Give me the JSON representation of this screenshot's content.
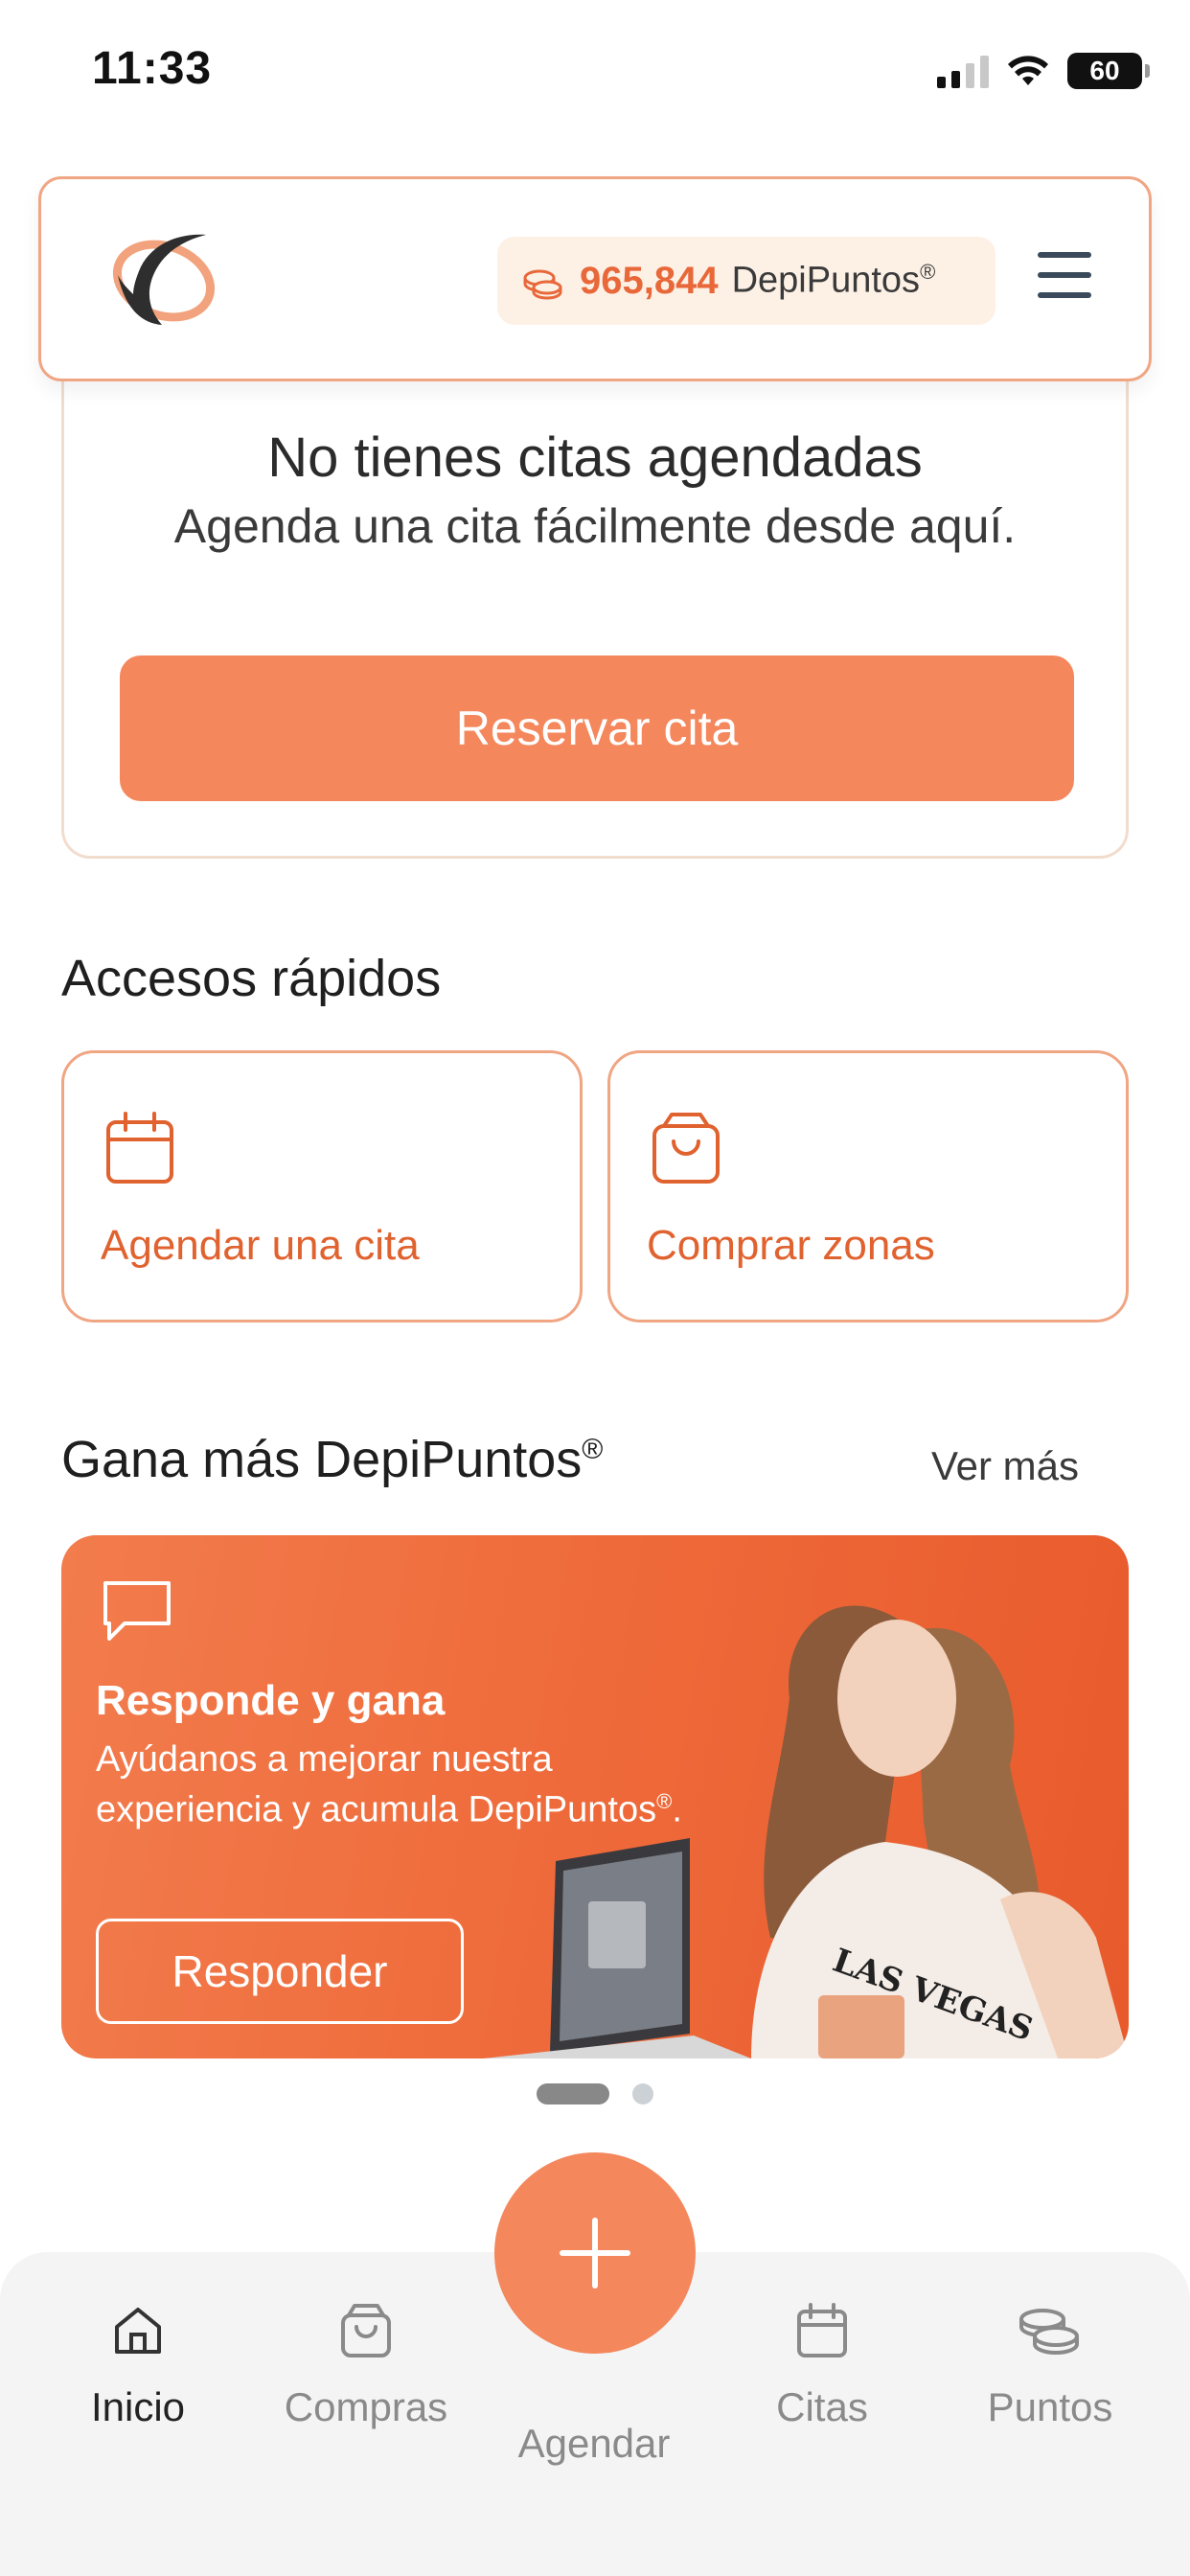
{
  "status_bar": {
    "time": "11:33",
    "battery": "60"
  },
  "header": {
    "points_value": "965,844",
    "points_label": "DepiPuntos",
    "points_mark": "®",
    "brand_color": "#f4875c"
  },
  "appointments": {
    "title": "No tienes citas agendadas",
    "subtitle": "Agenda una cita fácilmente desde aquí.",
    "reserve_label": "Reservar cita"
  },
  "quick_access": {
    "title": "Accesos rápidos",
    "items": [
      {
        "label": "Agendar una cita",
        "icon": "calendar-icon"
      },
      {
        "label": "Comprar zonas",
        "icon": "shopping-bag-icon"
      }
    ]
  },
  "earn_more": {
    "title": "Gana más DepiPuntos",
    "title_mark": "®",
    "see_more": "Ver más",
    "banner": {
      "icon": "chat-bubble-icon",
      "title": "Responde y gana",
      "text": "Ayúdanos a mejorar nuestra experiencia y acumula DepiPuntos",
      "text_mark": "®",
      "text_end": ".",
      "button": "Responder"
    },
    "carousel": {
      "count": 2,
      "active": 1
    }
  },
  "bottom_nav": {
    "items": [
      {
        "label": "Inicio",
        "icon": "home-icon",
        "active": true
      },
      {
        "label": "Compras",
        "icon": "shopping-bag-icon",
        "active": false
      },
      {
        "label": "Agendar",
        "icon": "plus-icon",
        "active": false
      },
      {
        "label": "Citas",
        "icon": "calendar-icon",
        "active": false
      },
      {
        "label": "Puntos",
        "icon": "coins-icon",
        "active": false
      }
    ]
  }
}
